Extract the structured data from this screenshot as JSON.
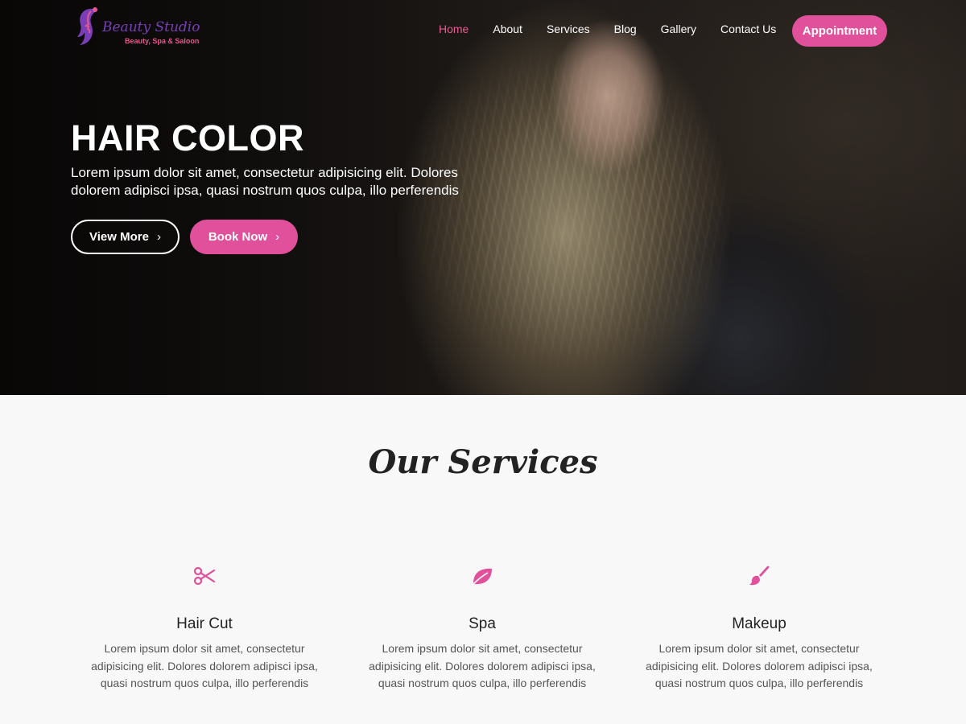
{
  "brand": {
    "name": "Beauty Studio",
    "tagline": "Beauty, Spa & Saloon",
    "accent_color": "#e0509b",
    "logo_color": "#7a3fb8"
  },
  "nav": {
    "items": [
      {
        "label": "Home",
        "active": true
      },
      {
        "label": "About",
        "active": false
      },
      {
        "label": "Services",
        "active": false
      },
      {
        "label": "Blog",
        "active": false
      },
      {
        "label": "Gallery",
        "active": false
      },
      {
        "label": "Contact Us",
        "active": false
      }
    ],
    "cta_label": "Appointment"
  },
  "hero": {
    "title": "HAIR COLOR",
    "text": "Lorem ipsum dolor sit amet, consectetur adipisicing elit. Dolores dolorem adipisci ipsa, quasi nostrum quos culpa, illo perferendis",
    "view_more_label": "View More",
    "book_now_label": "Book Now",
    "chevron_icon": "chevron-right-icon"
  },
  "services": {
    "heading": "Our Services",
    "items": [
      {
        "icon": "scissors-icon",
        "title": "Hair Cut",
        "text": "Lorem ipsum dolor sit amet, consectetur adipisicing elit. Dolores dolorem adipisci ipsa, quasi nostrum quos culpa, illo perferendis"
      },
      {
        "icon": "leaf-icon",
        "title": "Spa",
        "text": "Lorem ipsum dolor sit amet, consectetur adipisicing elit. Dolores dolorem adipisci ipsa, quasi nostrum quos culpa, illo perferendis"
      },
      {
        "icon": "brush-icon",
        "title": "Makeup",
        "text": "Lorem ipsum dolor sit amet, consectetur adipisicing elit. Dolores dolorem adipisci ipsa, quasi nostrum quos culpa, illo perferendis"
      }
    ]
  }
}
